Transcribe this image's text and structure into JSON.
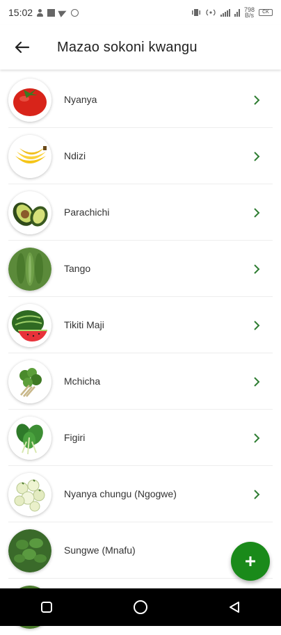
{
  "status_bar": {
    "time": "15:02",
    "data_speed_top": "798",
    "data_speed_bottom": "B/s",
    "battery": "CK"
  },
  "header": {
    "title": "Mazao sokoni kwangu",
    "back_icon": "arrow-left-icon"
  },
  "crops": [
    {
      "label": "Nyanya"
    },
    {
      "label": "Ndizi"
    },
    {
      "label": "Parachichi"
    },
    {
      "label": "Tango"
    },
    {
      "label": "Tikiti Maji"
    },
    {
      "label": "Mchicha"
    },
    {
      "label": "Figiri"
    },
    {
      "label": "Nyanya chungu (Ngogwe)"
    },
    {
      "label": "Sungwe (Mnafu)"
    }
  ],
  "fab": {
    "icon": "plus-icon"
  },
  "colors": {
    "accent": "#1a8a1a",
    "chevron": "#2e7d32",
    "navbar": "#000000"
  },
  "nav": {
    "recents_icon": "square-icon",
    "home_icon": "circle-icon",
    "back_icon": "triangle-back-icon"
  }
}
